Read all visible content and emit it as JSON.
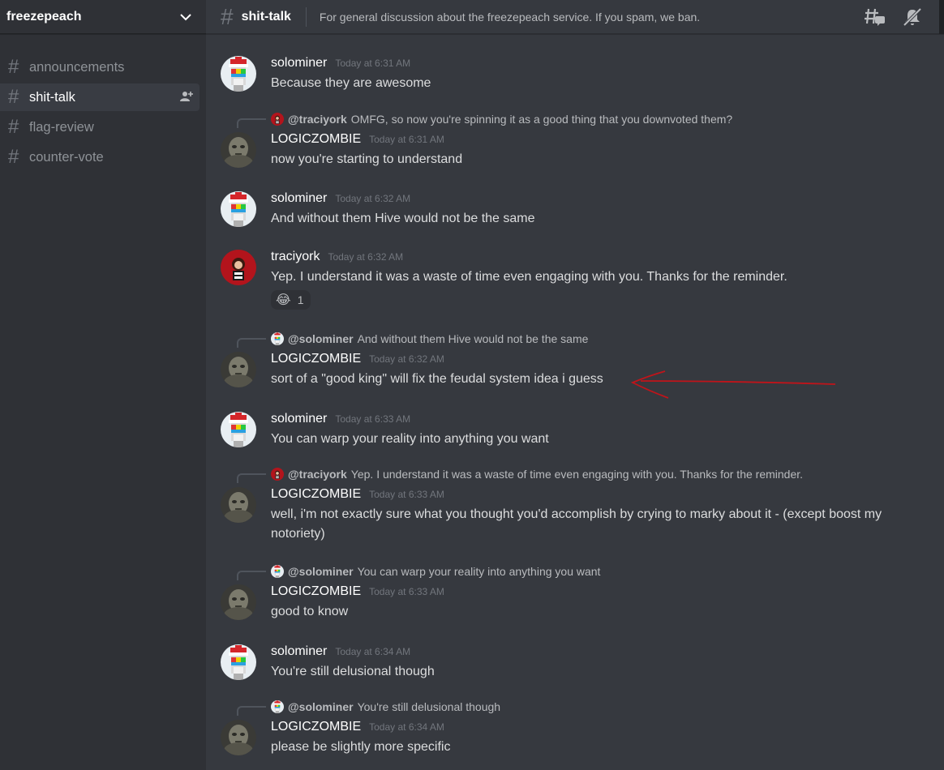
{
  "server": {
    "name": "freezepeach"
  },
  "sidebar": {
    "channels": [
      {
        "name": "announcements"
      },
      {
        "name": "shit-talk"
      },
      {
        "name": "flag-review"
      },
      {
        "name": "counter-vote"
      }
    ]
  },
  "header": {
    "channel_name": "shit-talk",
    "topic": "For general discussion about the freezepeach service. If you spam, we ban."
  },
  "messages": [
    {
      "user": "solominer",
      "time": "Today at 6:31 AM",
      "text": "Because they are awesome"
    },
    {
      "reply_user": "@traciyork",
      "reply_text": "OMFG, so now you're spinning it as a good thing that you downvoted them?",
      "user": "LOGICZOMBIE",
      "time": "Today at 6:31 AM",
      "text": "now you're starting to understand"
    },
    {
      "user": "solominer",
      "time": "Today at 6:32 AM",
      "text": "And without them Hive would not be the same"
    },
    {
      "user": "traciyork",
      "time": "Today at 6:32 AM",
      "text": "Yep. I understand it was a waste of time even engaging with you. Thanks for the reminder.",
      "reaction_count": "1"
    },
    {
      "reply_user": "@solominer",
      "reply_text": "And without them Hive would not be the same",
      "user": "LOGICZOMBIE",
      "time": "Today at 6:32 AM",
      "text": "sort of a \"good king\" will fix the feudal system idea i guess"
    },
    {
      "user": "solominer",
      "time": "Today at 6:33 AM",
      "text": "You can warp your reality into anything you want"
    },
    {
      "reply_user": "@traciyork",
      "reply_text": "Yep. I understand it was a waste of time even engaging with you. Thanks for the reminder.",
      "user": "LOGICZOMBIE",
      "time": "Today at 6:33 AM",
      "text": "well, i'm not exactly sure what you thought you'd accomplish by crying to marky about it - (except boost my notoriety)"
    },
    {
      "reply_user": "@solominer",
      "reply_text": "You can warp your reality into anything you want",
      "user": "LOGICZOMBIE",
      "time": "Today at 6:33 AM",
      "text": "good to know"
    },
    {
      "user": "solominer",
      "time": "Today at 6:34 AM",
      "text": "You're still delusional though"
    },
    {
      "reply_user": "@solominer",
      "reply_text": "You're still delusional though",
      "user": "LOGICZOMBIE",
      "time": "Today at 6:34 AM",
      "text": "please be slightly more specific"
    }
  ],
  "icons": {
    "threads": "threads-icon",
    "mute": "bell-slash-icon",
    "invite": "add-user-icon",
    "reaction": "joy-emoji"
  },
  "colors": {
    "annotation_arrow": "#c0141a"
  }
}
